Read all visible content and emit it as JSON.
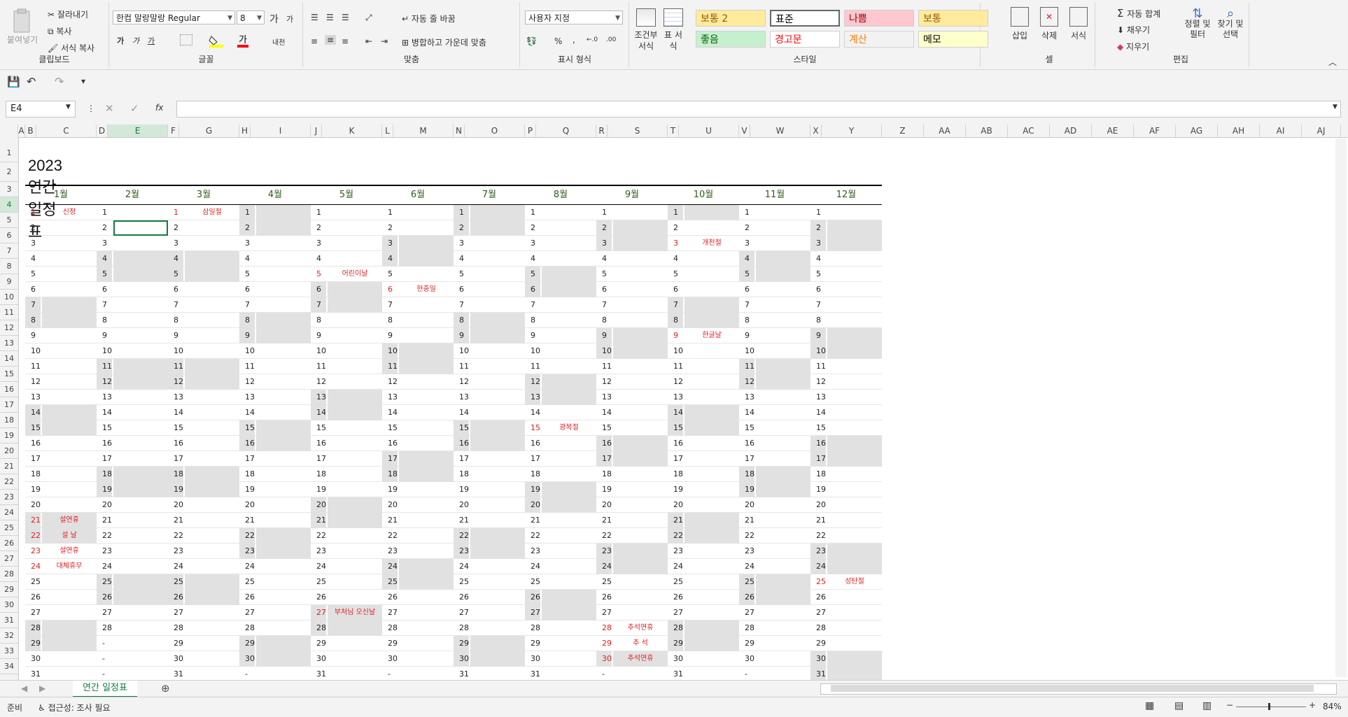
{
  "ribbon": {
    "clipboard": {
      "paste": "붙여넣기",
      "cut": "잘라내기",
      "copy": "복사",
      "format_painter": "서식 복사",
      "label": "클립보드"
    },
    "font": {
      "name": "한컴 말랑말랑 Regular",
      "size": "8",
      "label": "글꼴",
      "bold": "가",
      "italic": "가",
      "underline": "가",
      "grow": "가",
      "shrink": "가",
      "phonetic": "내천"
    },
    "alignment": {
      "wrap": "자동 줄 바꿈",
      "merge": "병합하고 가운데 맞춤",
      "label": "맞춤"
    },
    "number": {
      "format": "사용자 지정",
      "percent": "%",
      "comma": ",",
      "label": "표시 형식"
    },
    "styles": {
      "conditional": "조건부 서식",
      "table": "표 서식",
      "label": "스타일",
      "cells": [
        {
          "text": "보통 2",
          "bg": "#ffeb9c",
          "fg": "#9c5700"
        },
        {
          "text": "표준",
          "bg": "#ffffff",
          "fg": "#000000"
        },
        {
          "text": "나쁨",
          "bg": "#ffc7ce",
          "fg": "#9c0006"
        },
        {
          "text": "보통",
          "bg": "#ffeb9c",
          "fg": "#9c5700"
        },
        {
          "text": "좋음",
          "bg": "#c6efce",
          "fg": "#006100"
        },
        {
          "text": "경고문",
          "bg": "#ffffff",
          "fg": "#ff0000"
        },
        {
          "text": "계산",
          "bg": "#f2f2f2",
          "fg": "#fa7d00"
        },
        {
          "text": "메모",
          "bg": "#ffffcc",
          "fg": "#000000"
        }
      ]
    },
    "cells": {
      "insert": "삽입",
      "delete": "삭제",
      "format": "서식",
      "label": "셀"
    },
    "editing": {
      "autosum": "자동 합계",
      "fill": "채우기",
      "clear": "지우기",
      "sort": "정렬 및 필터",
      "find": "찾기 및 선택",
      "label": "편집"
    }
  },
  "namebox": "E4",
  "fx": "fx",
  "columns": [
    "A",
    "B",
    "C",
    "D",
    "E",
    "F",
    "G",
    "H",
    "I",
    "J",
    "K",
    "L",
    "M",
    "N",
    "O",
    "P",
    "Q",
    "R",
    "S",
    "T",
    "U",
    "V",
    "W",
    "X",
    "Y",
    "Z",
    "AA",
    "AB",
    "AC",
    "AD",
    "AE",
    "AF",
    "AG",
    "AH",
    "AI",
    "AJ"
  ],
  "sheet_title": "2023 연간 일정표",
  "months": [
    "1월",
    "2월",
    "3월",
    "4월",
    "5월",
    "6월",
    "7월",
    "8월",
    "9월",
    "10월",
    "11월",
    "12월"
  ],
  "days_in_month": [
    31,
    28,
    31,
    30,
    31,
    30,
    31,
    31,
    30,
    31,
    30,
    31
  ],
  "shaded": [
    [
      7,
      8,
      14,
      15,
      21,
      22,
      28,
      29
    ],
    [
      4,
      5,
      11,
      12,
      18,
      19,
      25,
      26
    ],
    [
      4,
      5,
      11,
      12,
      18,
      19,
      25,
      26
    ],
    [
      1,
      2,
      8,
      9,
      15,
      16,
      22,
      23,
      29,
      30
    ],
    [
      6,
      7,
      13,
      14,
      20,
      21,
      27,
      28
    ],
    [
      3,
      4,
      10,
      11,
      17,
      18,
      24,
      25
    ],
    [
      1,
      2,
      8,
      9,
      15,
      16,
      22,
      23,
      29,
      30
    ],
    [
      5,
      6,
      12,
      13,
      19,
      20,
      26,
      27
    ],
    [
      2,
      3,
      9,
      10,
      16,
      17,
      23,
      24,
      30
    ],
    [
      1,
      7,
      8,
      14,
      15,
      21,
      22,
      28,
      29
    ],
    [
      4,
      5,
      11,
      12,
      18,
      19,
      25,
      26
    ],
    [
      2,
      3,
      9,
      10,
      16,
      17,
      23,
      24,
      30,
      31
    ]
  ],
  "holidays": [
    {
      "m": 0,
      "d": 1,
      "t": "신정"
    },
    {
      "m": 0,
      "d": 21,
      "t": "설연휴"
    },
    {
      "m": 0,
      "d": 22,
      "t": "설 날"
    },
    {
      "m": 0,
      "d": 23,
      "t": "설연휴"
    },
    {
      "m": 0,
      "d": 24,
      "t": "대체휴무"
    },
    {
      "m": 2,
      "d": 1,
      "t": "삼일절"
    },
    {
      "m": 4,
      "d": 5,
      "t": "어린이날"
    },
    {
      "m": 4,
      "d": 27,
      "t": "부처님 오신날"
    },
    {
      "m": 5,
      "d": 6,
      "t": "현충일"
    },
    {
      "m": 7,
      "d": 15,
      "t": "광복절"
    },
    {
      "m": 8,
      "d": 28,
      "t": "추석연휴"
    },
    {
      "m": 8,
      "d": 29,
      "t": "추 석"
    },
    {
      "m": 8,
      "d": 30,
      "t": "추석연휴"
    },
    {
      "m": 9,
      "d": 3,
      "t": "개천절"
    },
    {
      "m": 9,
      "d": 9,
      "t": "한글날"
    },
    {
      "m": 11,
      "d": 25,
      "t": "성탄절"
    }
  ],
  "sheet_tab": "연간 일정표",
  "status": {
    "ready": "준비",
    "accessibility": "접근성: 조사 필요",
    "zoom": "84%"
  }
}
